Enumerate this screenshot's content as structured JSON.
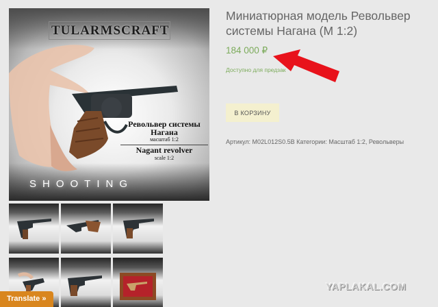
{
  "product": {
    "title": "Миниатюрная модель Револьвер системы Нагана (М 1:2)",
    "price": "184 000 ₽",
    "availability": "Доступно для предзаказа",
    "cart_button_label": "В КОРЗИНУ",
    "meta_line": "Артикул: M02L012S0.5B Категории: Масштаб 1:2, Револьверы"
  },
  "main_image": {
    "brand": "TULARMSCRAFT",
    "title_ru": "Револьвер системы",
    "title_ru_2": "Нагана",
    "scale_ru": "масштаб 1:2",
    "title_en": "Nagant revolver",
    "scale_en": "scale 1:2",
    "shooting": "SHOOTING"
  },
  "annotation": {
    "arrow_color": "#e8121b"
  },
  "watermark": "YAPLAKAL.COM",
  "translate_button": "Translate »",
  "colors": {
    "accent_green": "#7cab5b",
    "cart_bg": "#f4f0cf",
    "translate_bg": "#d9861e"
  }
}
